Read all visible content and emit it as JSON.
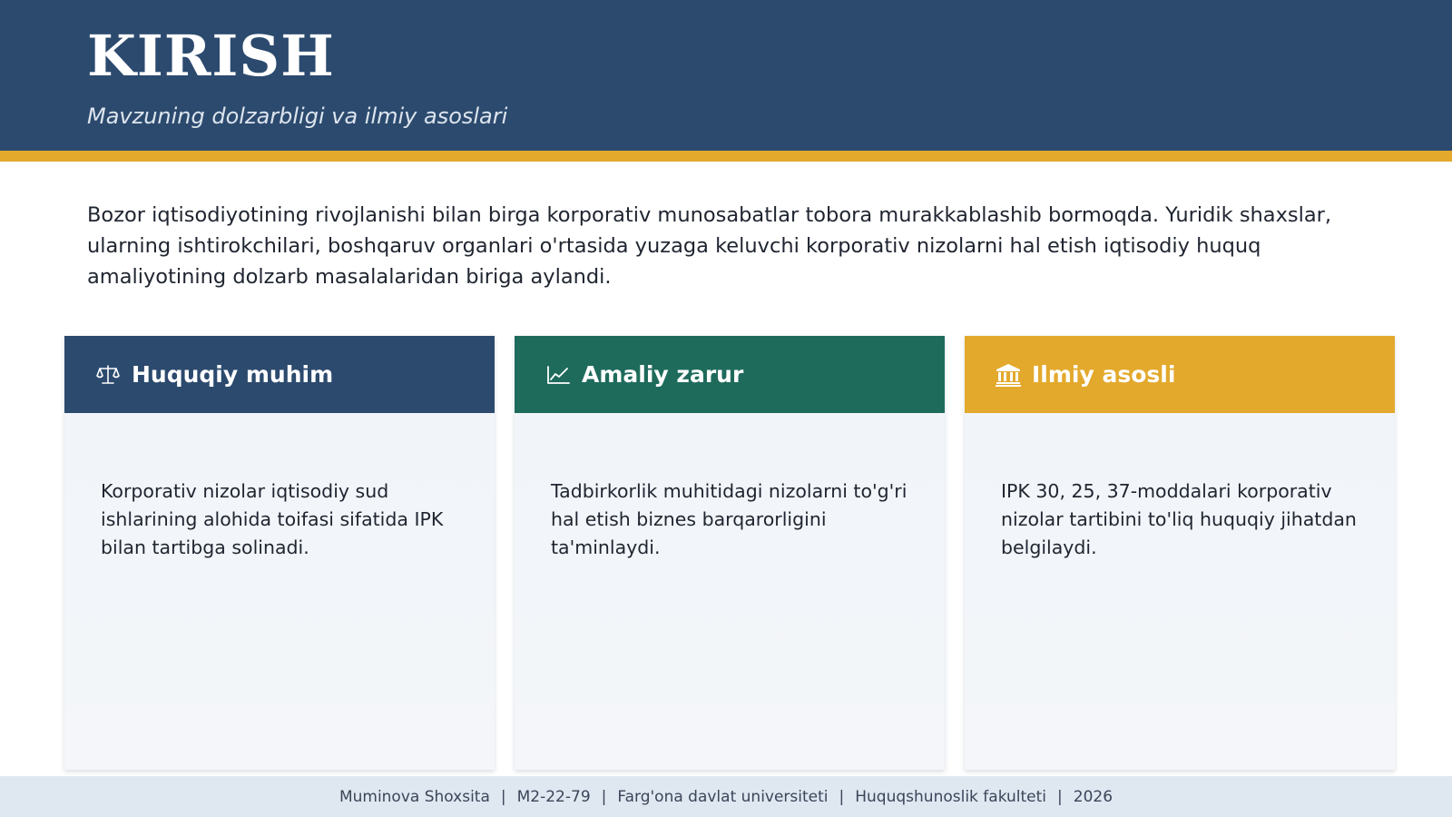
{
  "header": {
    "title": "KIRISH",
    "subtitle": "Mavzuning dolzarbligi va ilmiy asoslari"
  },
  "intro": "Bozor iqtisodiyotining rivojlanishi bilan birga korporativ munosabatlar tobora murakkablashib bormoqda. Yuridik shaxslar, ularning ishtirokchilari, boshqaruv organlari o'rtasida yuzaga keluvchi korporativ nizolarni hal etish iqtisodiy huquq amaliyotining dolzarb masalalaridan biriga aylandi.",
  "cards": [
    {
      "title": "Huquqiy muhim",
      "icon": "scales-icon",
      "color": "#2c4a6e",
      "body": "Korporativ nizolar iqtisodiy sud ishlarining alohida toifasi sifatida IPK bilan tartibga solinadi."
    },
    {
      "title": "Amaliy zarur",
      "icon": "chart-line-icon",
      "color": "#1e6b5c",
      "body": "Tadbirkorlik muhitidagi nizolarni to'g'ri hal etish biznes barqarorligini ta'minlaydi."
    },
    {
      "title": "Ilmiy asosli",
      "icon": "institution-icon",
      "color": "#e3a92c",
      "body": "IPK 30, 25, 37-moddalari korporativ nizolar tartibini to'liq huquqiy jihatdan belgilaydi."
    }
  ],
  "footer": {
    "author": "Muminova Shoxsita",
    "group": "M2-22-79",
    "university": "Farg'ona davlat universiteti",
    "faculty": "Huquqshunoslik fakulteti",
    "year": "2026",
    "separator": "|"
  },
  "colors": {
    "header_bg": "#2c4a6e",
    "accent_gold": "#e3a92c",
    "accent_green": "#1e6b5c",
    "footer_bg": "#dfe7f1"
  }
}
